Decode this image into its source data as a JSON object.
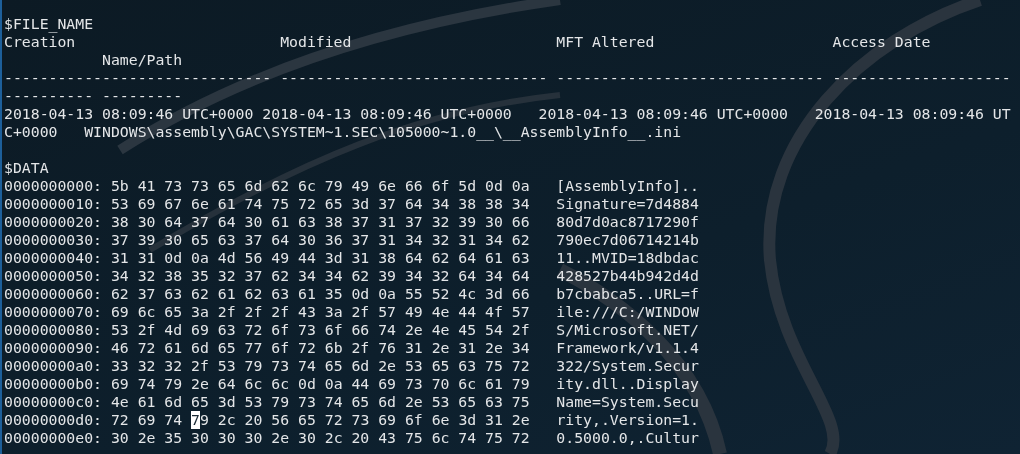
{
  "file_name": {
    "title": "$FILE_NAME",
    "header_lines": [
      "Creation                       Modified                       MFT Altered                    Access Date",
      "           Name/Path"
    ],
    "rule_lines": [
      "------------------------------ ------------------------------ ------------------------------ --------------------",
      "---------- ---------"
    ],
    "record_lines": [
      "2018-04-13 08:09:46 UTC+0000 2018-04-13 08:09:46 UTC+0000   2018-04-13 08:09:46 UTC+0000   2018-04-13 08:09:46 UT",
      "C+0000   WINDOWS\\assembly\\GAC\\SYSTEM~1.SEC\\105000~1.0__\\__AssemblyInfo__.ini"
    ]
  },
  "data": {
    "title": "$DATA",
    "rows": [
      {
        "offset": "0000000000:",
        "hex": "5b 41 73 73 65 6d 62 6c 79 49 6e 66 6f 5d 0d 0a",
        "ascii": "[AssemblyInfo].."
      },
      {
        "offset": "0000000010:",
        "hex": "53 69 67 6e 61 74 75 72 65 3d 37 64 34 38 38 34",
        "ascii": "Signature=7d4884"
      },
      {
        "offset": "0000000020:",
        "hex": "38 30 64 37 64 30 61 63 38 37 31 37 32 39 30 66",
        "ascii": "80d7d0ac8717290f"
      },
      {
        "offset": "0000000030:",
        "hex": "37 39 30 65 63 37 64 30 36 37 31 34 32 31 34 62",
        "ascii": "790ec7d06714214b"
      },
      {
        "offset": "0000000040:",
        "hex": "31 31 0d 0a 4d 56 49 44 3d 31 38 64 62 64 61 63",
        "ascii": "11..MVID=18dbdac"
      },
      {
        "offset": "0000000050:",
        "hex": "34 32 38 35 32 37 62 34 34 62 39 34 32 64 34 64",
        "ascii": "428527b44b942d4d"
      },
      {
        "offset": "0000000060:",
        "hex": "62 37 63 62 61 62 63 61 35 0d 0a 55 52 4c 3d 66",
        "ascii": "b7cbabca5..URL=f"
      },
      {
        "offset": "0000000070:",
        "hex": "69 6c 65 3a 2f 2f 2f 43 3a 2f 57 49 4e 44 4f 57",
        "ascii": "ile:///C:/WINDOW"
      },
      {
        "offset": "0000000080:",
        "hex": "53 2f 4d 69 63 72 6f 73 6f 66 74 2e 4e 45 54 2f",
        "ascii": "S/Microsoft.NET/"
      },
      {
        "offset": "0000000090:",
        "hex": "46 72 61 6d 65 77 6f 72 6b 2f 76 31 2e 31 2e 34",
        "ascii": "Framework/v1.1.4"
      },
      {
        "offset": "00000000a0:",
        "hex": "33 32 32 2f 53 79 73 74 65 6d 2e 53 65 63 75 72",
        "ascii": "322/System.Secur"
      },
      {
        "offset": "00000000b0:",
        "hex": "69 74 79 2e 64 6c 6c 0d 0a 44 69 73 70 6c 61 79",
        "ascii": "ity.dll..Display"
      },
      {
        "offset": "00000000c0:",
        "hex": "4e 61 6d 65 3d 53 79 73 74 65 6d 2e 53 65 63 75",
        "ascii": "Name=System.Secu"
      },
      {
        "offset": "00000000d0:",
        "hex_parts": [
          {
            "text": "72 69 74 ",
            "cursor": false
          },
          {
            "text": "7",
            "cursor": true
          },
          {
            "text": "9 2c 20 56 65 72 73 69 6f 6e 3d 31 2e",
            "cursor": false
          }
        ],
        "ascii": "rity,.Version=1."
      },
      {
        "offset": "00000000e0:",
        "hex": "30 2e 35 30 30 30 2e 30 2c 20 43 75 6c 74 75 72",
        "ascii": "0.5000.0,.Cultur"
      }
    ]
  }
}
